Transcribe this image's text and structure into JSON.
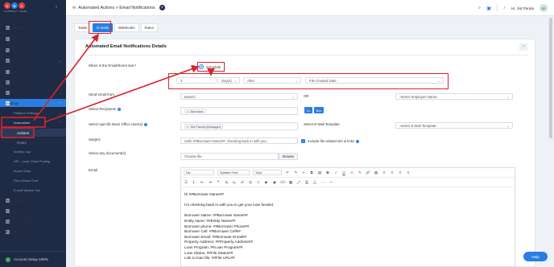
{
  "brand": {
    "letters": [
      "C",
      "B",
      "C"
    ],
    "name": "COMPANY NAME",
    "colors": [
      "#e2403c",
      "#2a7de1",
      "#e2403c"
    ]
  },
  "sidebar": {
    "items": [
      {
        "label": "Dashboard",
        "icon": "dashboard-icon"
      },
      {
        "label": "Create Loan",
        "icon": "plus-square-icon"
      },
      {
        "label": "Pipeline",
        "icon": "pipeline-icon"
      },
      {
        "label": "User / Contacts",
        "icon": "user-icon"
      },
      {
        "label": "Calendar/Tasks",
        "icon": "calendar-icon"
      },
      {
        "label": "Reports",
        "icon": "reports-icon"
      },
      {
        "label": "Calculators",
        "icon": "calculator-icon"
      },
      {
        "label": "Settings",
        "icon": "gear-icon"
      },
      {
        "label": "Platform Settings"
      },
      {
        "label": "Automation"
      },
      {
        "label": "Actions"
      },
      {
        "label": "Rules"
      },
      {
        "label": "Activity Log"
      },
      {
        "label": "API - Lead / Data Posting"
      },
      {
        "label": "Import Data"
      },
      {
        "label": "Plan Wizard Tool"
      },
      {
        "label": "E-mail Wizard Tool"
      },
      {
        "label": "Help Center",
        "icon": "help-icon"
      },
      {
        "label": "User Trainings",
        "icon": "training-icon"
      },
      {
        "label": "Vote for Features",
        "icon": "vote-icon"
      },
      {
        "label": "Release Notes",
        "icon": "notes-icon"
      }
    ],
    "account_setup": "Account Setup 100%"
  },
  "header": {
    "breadcrumb": "Automated Actions > Email Notifications",
    "help": "?",
    "user": "Hi, Sid Panda",
    "avatar": "SP"
  },
  "tabs": [
    "Tasks",
    "E-mails",
    "Webhooks",
    "Rules"
  ],
  "card": {
    "title": "Automated Email Notifications Details",
    "when_label": "When is the Email/Event due?",
    "radio_prefix": "R",
    "schedule_label": "Schedule",
    "schedule_days": "3",
    "schedule_unit": "Day(s)",
    "schedule_when": "After",
    "schedule_field": "File Created Date",
    "send_from_label": "Send email from",
    "send_from_value": "Branch",
    "or_label": "OR",
    "employee_placeholder": "-Select Employee Name-",
    "recipients_label": "Select Recipients",
    "recipient_tag": "Borrower",
    "cc_label": "Cc",
    "bcc_label": "Bcc",
    "backoffice_label": "Select specific Back Office User(s)",
    "backoffice_tag": "Sid Panda (Manager)",
    "template_label": "Select E-Mail Template",
    "template_placeholder": "-Select E-Mail Template-",
    "subject_label": "Subject",
    "subject_value": "Hello ##Borrower Name##, checking back in with you.",
    "include_label": "Include file related info & links",
    "documents_label": "Select any document(s)",
    "choose_file": "Choose file",
    "browse": "Browse",
    "email_label": "Email"
  },
  "editor": {
    "block": "Div",
    "font": "System Font",
    "size": "12pt",
    "body": [
      "Hi ##Borrower Name##",
      "",
      "I'm checking back in with you to get your loan funded.",
      "",
      "Borrower Name: ##Borrower Name##",
      "Entity name: ##Entity Name##",
      "Borrower phone: ##Borrower Phone##",
      "Borrower Cell: ##Borrower Cell##",
      "Borrower Email: ##Borrower Email##",
      "Property Address: ##Property Address##",
      "Loan Program: ##Loan Program##",
      "Loan Status: ##File Status##",
      "Link to loan file: ##File URL##"
    ]
  },
  "chat": "Help"
}
